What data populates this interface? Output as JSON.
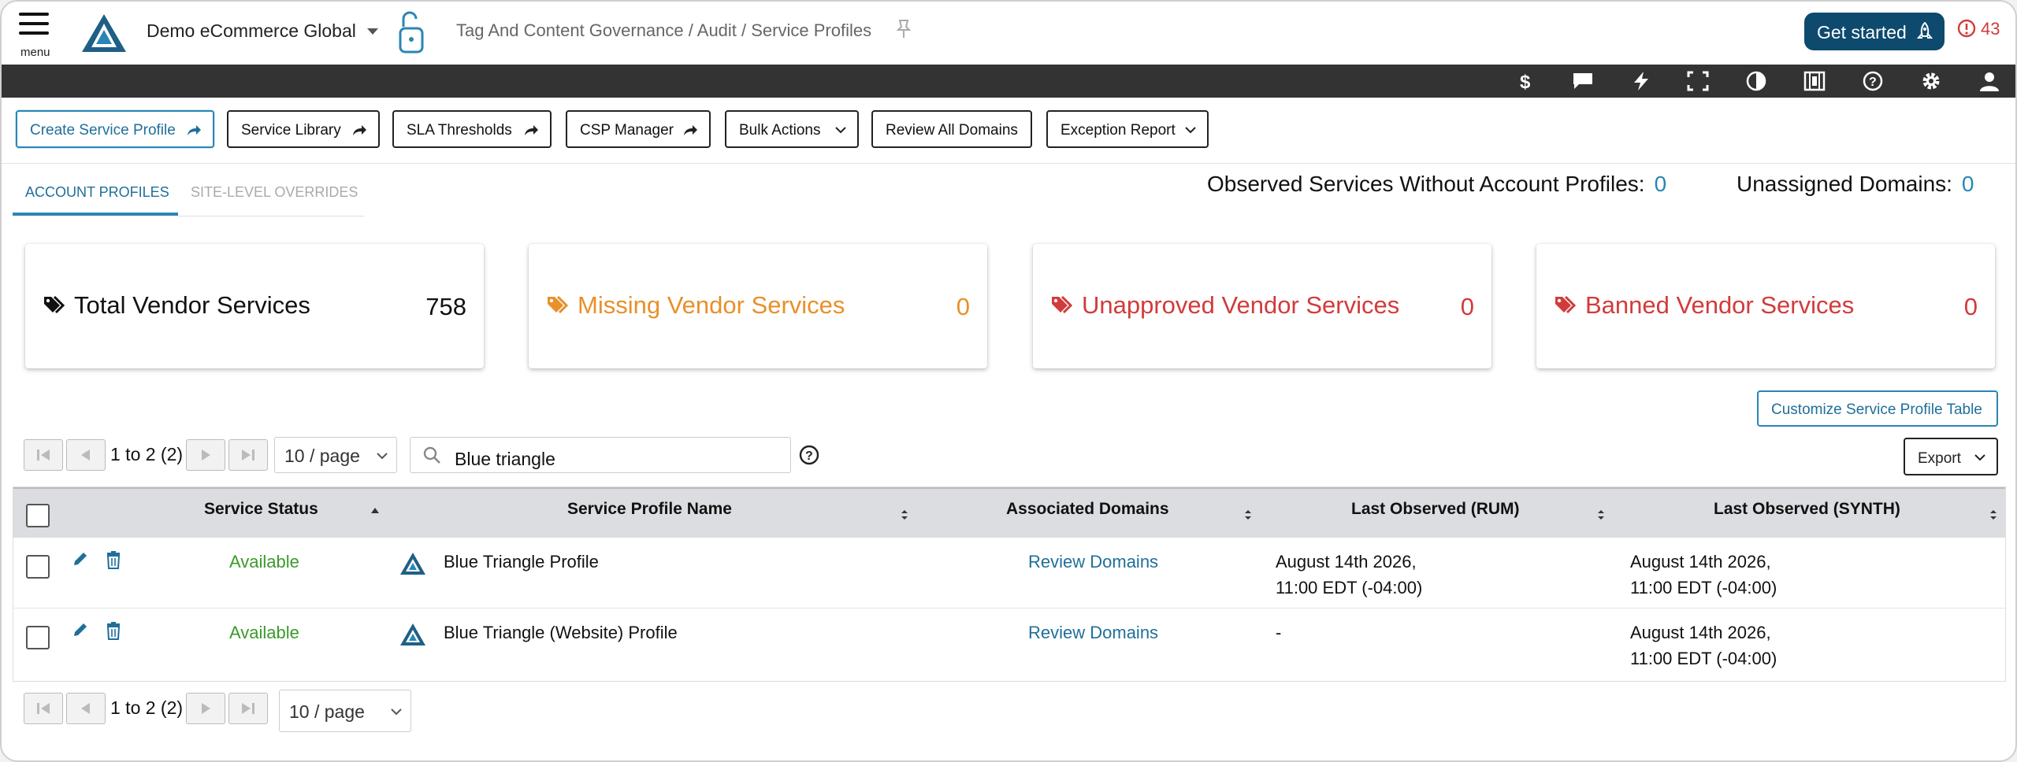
{
  "header": {
    "menu_label": "menu",
    "account": "Demo eCommerce Global",
    "breadcrumb": "Tag And Content Governance / Audit / Service Profiles",
    "get_started": "Get started",
    "alert_count": "43",
    "brand_color": "#0e4a6e",
    "alert_color": "#d23b3b"
  },
  "toolbar_icons": [
    "dollar-icon",
    "chat-icon",
    "lightning-icon",
    "fullscreen-icon",
    "contrast-icon",
    "film-icon",
    "help-icon",
    "gear-icon",
    "user-icon"
  ],
  "actions": {
    "create": "Create Service Profile",
    "library": "Service Library",
    "sla": "SLA Thresholds",
    "csp": "CSP Manager",
    "bulk": "Bulk Actions",
    "review_all": "Review All Domains",
    "exception": "Exception Report"
  },
  "tabs": {
    "account_profiles": "ACCOUNT PROFILES",
    "site_overrides": "SITE-LEVEL OVERRIDES"
  },
  "summary": {
    "observed_label": "Observed Services Without Account Profiles:",
    "observed_value": "0",
    "unassigned_label": "Unassigned Domains:",
    "unassigned_value": "0"
  },
  "cards": [
    {
      "label": "Total Vendor Services",
      "value": "758",
      "color": "#111111"
    },
    {
      "label": "Missing Vendor Services",
      "value": "0",
      "color": "#e8902a"
    },
    {
      "label": "Unapproved Vendor Services",
      "value": "0",
      "color": "#d23b3b"
    },
    {
      "label": "Banned Vendor Services",
      "value": "0",
      "color": "#d23b3b"
    }
  ],
  "customize": "Customize Service Profile Table",
  "pager": {
    "range": "1 to 2 (2)",
    "per_page": "10 / page"
  },
  "search": {
    "value": "Blue triangle"
  },
  "export": "Export",
  "table": {
    "columns": [
      "Service Status",
      "Service Profile Name",
      "Associated Domains",
      "Last Observed (RUM)",
      "Last Observed (SYNTH)"
    ],
    "rows": [
      {
        "status": "Available",
        "name": "Blue Triangle Profile",
        "domains": "Review Domains",
        "rum_line1": "August 14th 2026,",
        "rum_line2": "11:00 EDT (-04:00)",
        "synth_line1": "August 14th 2026,",
        "synth_line2": "11:00 EDT (-04:00)"
      },
      {
        "status": "Available",
        "name": "Blue Triangle (Website) Profile",
        "domains": "Review Domains",
        "rum_line1": "-",
        "rum_line2": "",
        "synth_line1": "August 14th 2026,",
        "synth_line2": "11:00 EDT (-04:00)"
      }
    ]
  }
}
